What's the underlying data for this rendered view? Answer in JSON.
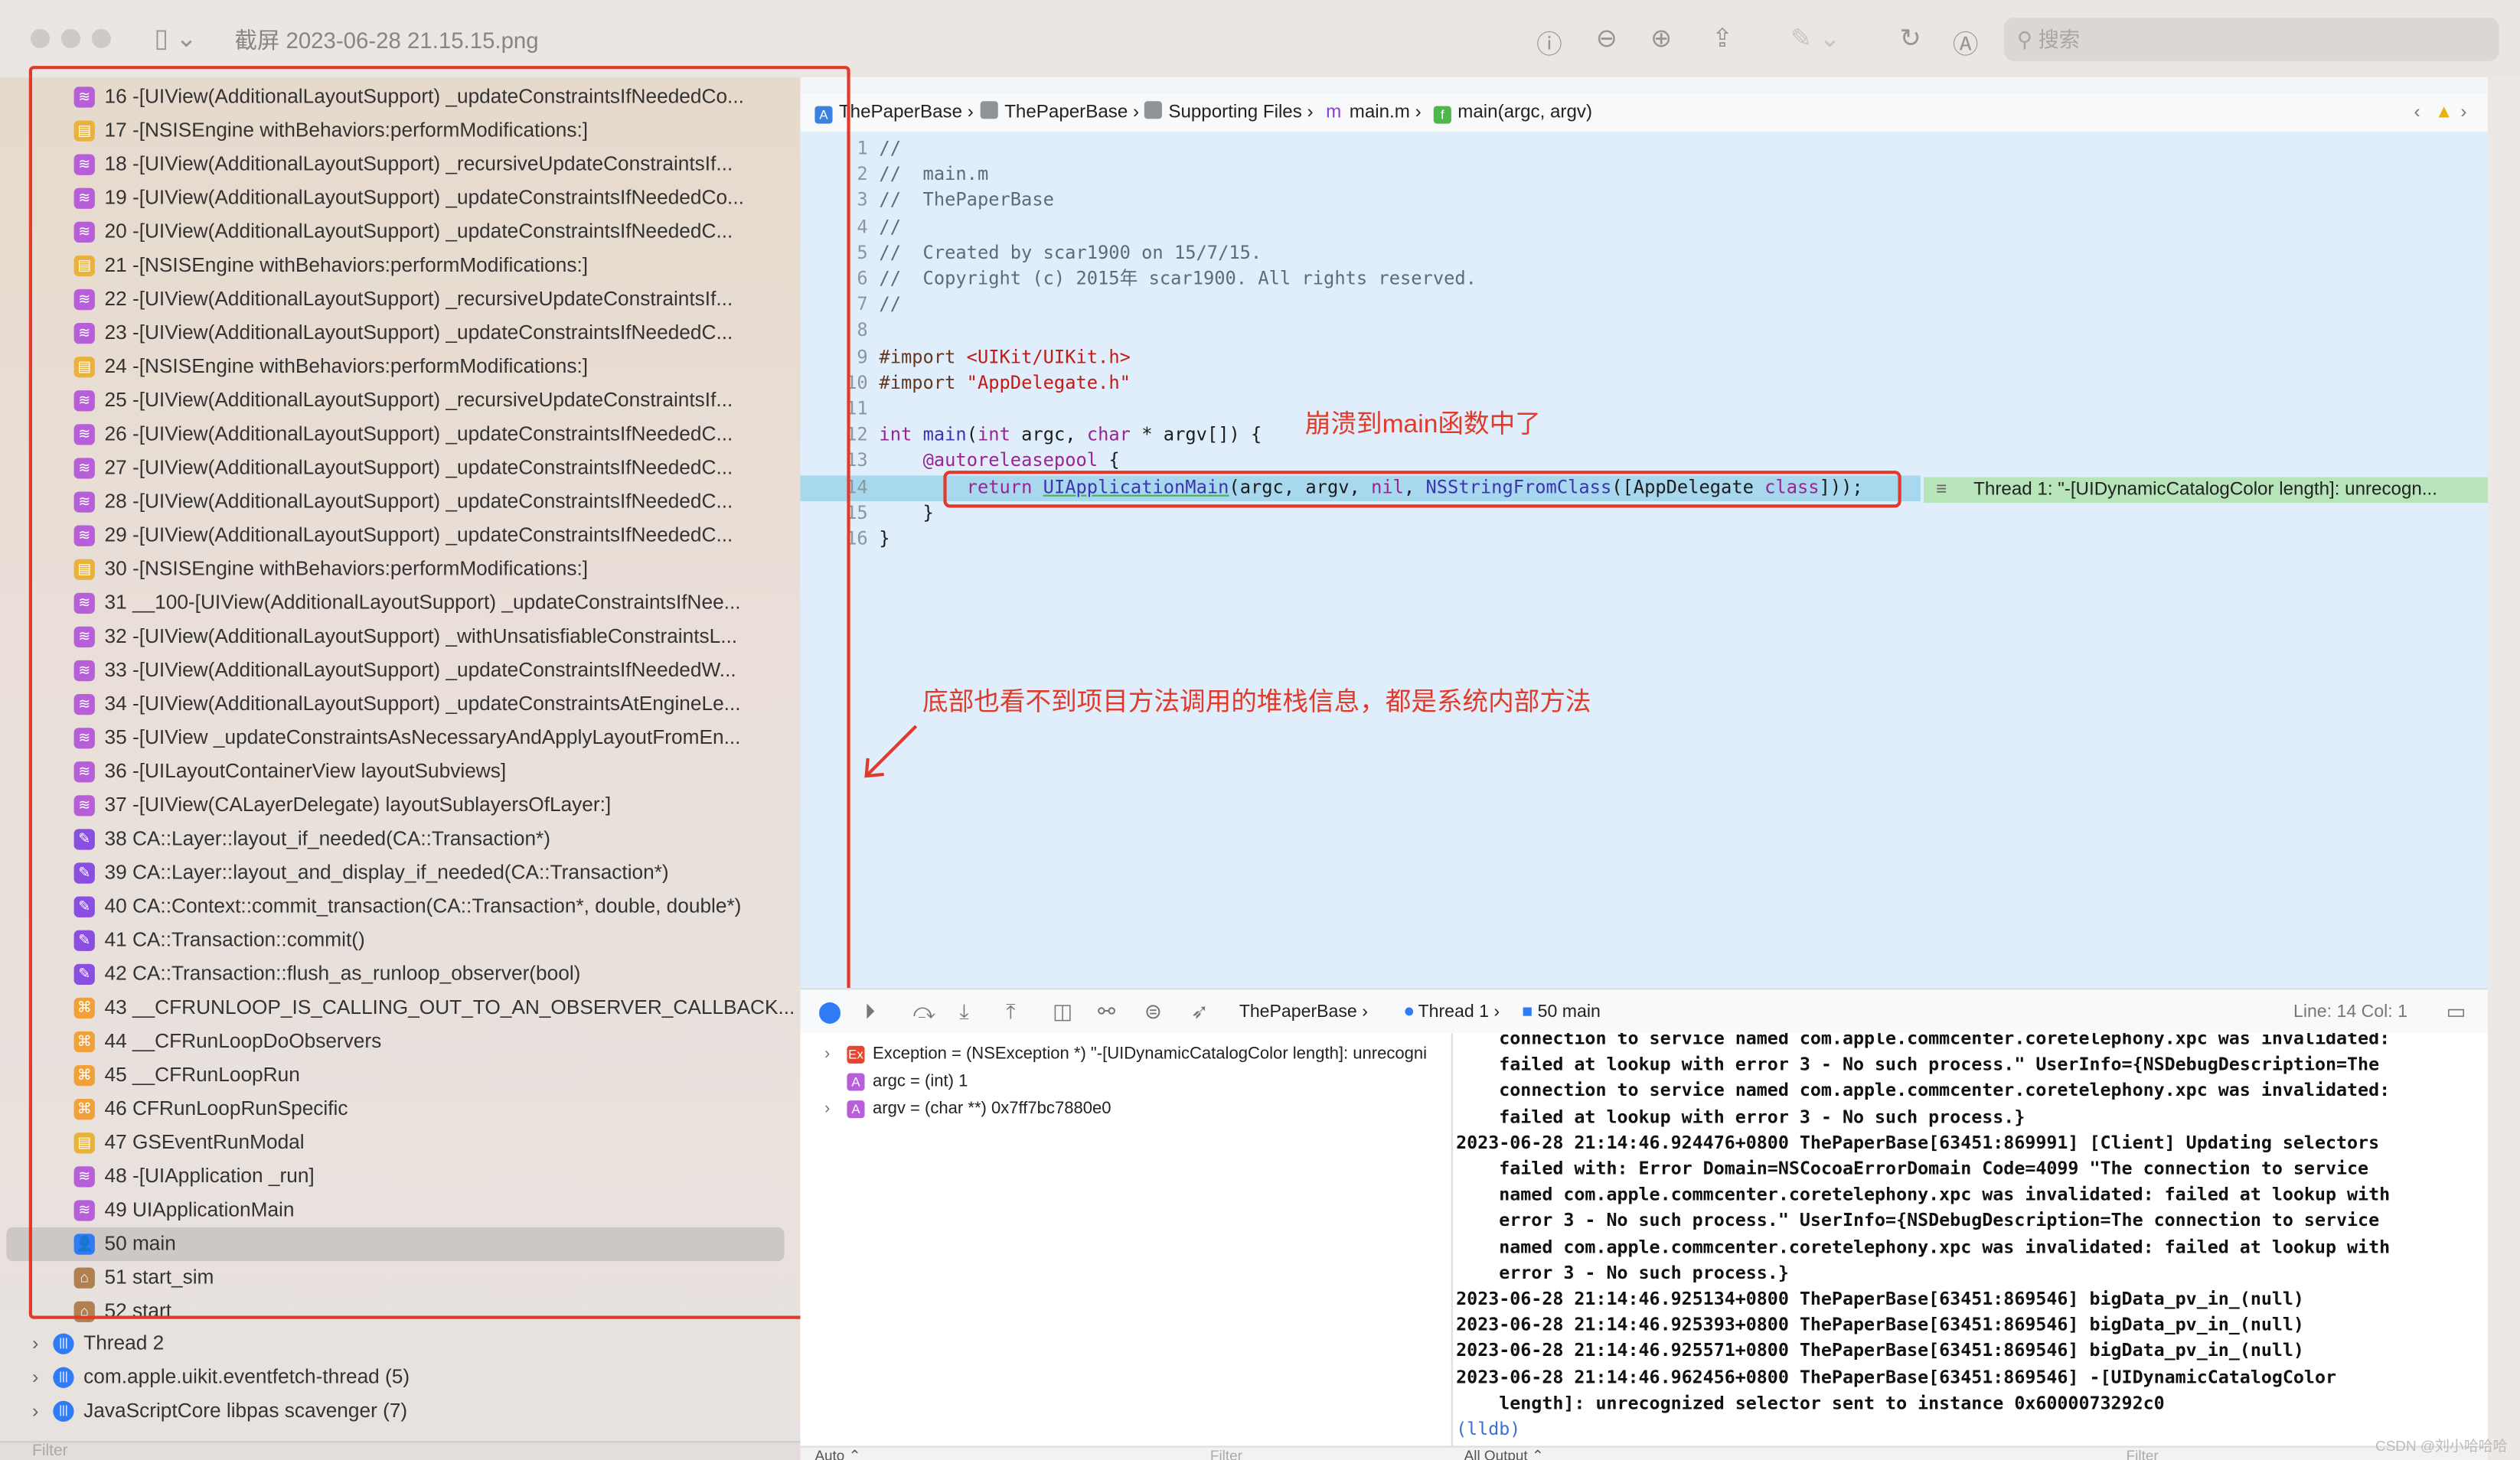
{
  "window": {
    "title": "截屏 2023-06-28 21.15.15.png",
    "search_placeholder": "搜索"
  },
  "colors": {
    "annotation": "#e23a2a",
    "highlight_line": "#a7d8ee",
    "error_banner": "#b7e4b8",
    "code_bg": "#dfeefa"
  },
  "stack_frames": [
    {
      "label": "16 -[UIView(AdditionalLayoutSupport) _updateConstraintsIfNeededCo...",
      "icon": "uikit"
    },
    {
      "label": "17 -[NSISEngine withBehaviors:performModifications:]",
      "icon": "foundation"
    },
    {
      "label": "18 -[UIView(AdditionalLayoutSupport) _recursiveUpdateConstraintsIf...",
      "icon": "uikit"
    },
    {
      "label": "19 -[UIView(AdditionalLayoutSupport) _updateConstraintsIfNeededCo...",
      "icon": "uikit"
    },
    {
      "label": "20 -[UIView(AdditionalLayoutSupport) _updateConstraintsIfNeededC...",
      "icon": "uikit"
    },
    {
      "label": "21 -[NSISEngine withBehaviors:performModifications:]",
      "icon": "foundation"
    },
    {
      "label": "22 -[UIView(AdditionalLayoutSupport) _recursiveUpdateConstraintsIf...",
      "icon": "uikit"
    },
    {
      "label": "23 -[UIView(AdditionalLayoutSupport) _updateConstraintsIfNeededC...",
      "icon": "uikit"
    },
    {
      "label": "24 -[NSISEngine withBehaviors:performModifications:]",
      "icon": "foundation"
    },
    {
      "label": "25 -[UIView(AdditionalLayoutSupport) _recursiveUpdateConstraintsIf...",
      "icon": "uikit"
    },
    {
      "label": "26 -[UIView(AdditionalLayoutSupport) _updateConstraintsIfNeededC...",
      "icon": "uikit"
    },
    {
      "label": "27 -[UIView(AdditionalLayoutSupport) _updateConstraintsIfNeededC...",
      "icon": "uikit"
    },
    {
      "label": "28 -[UIView(AdditionalLayoutSupport) _updateConstraintsIfNeededC...",
      "icon": "uikit"
    },
    {
      "label": "29 -[UIView(AdditionalLayoutSupport) _updateConstraintsIfNeededC...",
      "icon": "uikit"
    },
    {
      "label": "30 -[NSISEngine withBehaviors:performModifications:]",
      "icon": "foundation"
    },
    {
      "label": "31 __100-[UIView(AdditionalLayoutSupport) _updateConstraintsIfNee...",
      "icon": "uikit"
    },
    {
      "label": "32 -[UIView(AdditionalLayoutSupport) _withUnsatisfiableConstraintsL...",
      "icon": "uikit"
    },
    {
      "label": "33 -[UIView(AdditionalLayoutSupport) _updateConstraintsIfNeededW...",
      "icon": "uikit"
    },
    {
      "label": "34 -[UIView(AdditionalLayoutSupport) _updateConstraintsAtEngineLe...",
      "icon": "uikit"
    },
    {
      "label": "35 -[UIView _updateConstraintsAsNecessaryAndApplyLayoutFromEn...",
      "icon": "uikit"
    },
    {
      "label": "36 -[UILayoutContainerView layoutSubviews]",
      "icon": "uikit"
    },
    {
      "label": "37 -[UIView(CALayerDelegate) layoutSublayersOfLayer:]",
      "icon": "uikit"
    },
    {
      "label": "38 CA::Layer::layout_if_needed(CA::Transaction*)",
      "icon": "quartzcore"
    },
    {
      "label": "39 CA::Layer::layout_and_display_if_needed(CA::Transaction*)",
      "icon": "quartzcore"
    },
    {
      "label": "40 CA::Context::commit_transaction(CA::Transaction*, double, double*)",
      "icon": "quartzcore"
    },
    {
      "label": "41 CA::Transaction::commit()",
      "icon": "quartzcore"
    },
    {
      "label": "42 CA::Transaction::flush_as_runloop_observer(bool)",
      "icon": "quartzcore"
    },
    {
      "label": "43 __CFRUNLOOP_IS_CALLING_OUT_TO_AN_OBSERVER_CALLBACK...",
      "icon": "corefoundation"
    },
    {
      "label": "44 __CFRunLoopDoObservers",
      "icon": "corefoundation"
    },
    {
      "label": "45 __CFRunLoopRun",
      "icon": "corefoundation"
    },
    {
      "label": "46 CFRunLoopRunSpecific",
      "icon": "corefoundation"
    },
    {
      "label": "47 GSEventRunModal",
      "icon": "foundation"
    },
    {
      "label": "48 -[UIApplication _run]",
      "icon": "uikit"
    },
    {
      "label": "49 UIApplicationMain",
      "icon": "uikit"
    },
    {
      "label": "50 main",
      "icon": "user",
      "selected": true
    },
    {
      "label": "51 start_sim",
      "icon": "system"
    },
    {
      "label": "52 start",
      "icon": "system"
    }
  ],
  "threads": [
    {
      "label": "Thread 2"
    },
    {
      "label": "com.apple.uikit.eventfetch-thread (5)"
    },
    {
      "label": "JavaScriptCore libpas scavenger (7)"
    }
  ],
  "left_filter_placeholder": "Filter",
  "breadcrumb": [
    "ThePaperBase",
    "ThePaperBase",
    "Supporting Files",
    "main.m",
    "main(argc, argv)"
  ],
  "code_lines": [
    [
      [
        "//",
        "comment"
      ]
    ],
    [
      [
        "//  main.m",
        "comment"
      ]
    ],
    [
      [
        "//  ThePaperBase",
        "comment"
      ]
    ],
    [
      [
        "//",
        "comment"
      ]
    ],
    [
      [
        "//  Created by scar1900 on 15/7/15.",
        "comment"
      ]
    ],
    [
      [
        "//  Copyright (c) 2015年 scar1900. All rights reserved.",
        "comment"
      ]
    ],
    [
      [
        "//",
        "comment"
      ]
    ],
    [],
    [
      [
        "#import ",
        "pre"
      ],
      [
        "<UIKit/UIKit.h>",
        "str"
      ]
    ],
    [
      [
        "#import ",
        "pre"
      ],
      [
        "\"AppDelegate.h\"",
        "str"
      ]
    ],
    [],
    [
      [
        "int",
        "kw"
      ],
      [
        " ",
        "plain"
      ],
      [
        "main",
        "fn"
      ],
      [
        "(",
        "plain"
      ],
      [
        "int",
        "kw"
      ],
      [
        " argc, ",
        "plain"
      ],
      [
        "char",
        "kw"
      ],
      [
        " * argv[]) {",
        "plain"
      ]
    ],
    [
      [
        "    ",
        "plain"
      ],
      [
        "@autoreleasepool",
        "kw"
      ],
      [
        " {",
        "plain"
      ]
    ],
    [
      [
        "        ",
        "plain"
      ],
      [
        "return",
        "kw"
      ],
      [
        " ",
        "plain"
      ],
      [
        "UIApplicationMain",
        "und"
      ],
      [
        "(argc, argv, ",
        "plain"
      ],
      [
        "nil",
        "kw"
      ],
      [
        ", ",
        "plain"
      ],
      [
        "NSStringFromClass",
        "fn"
      ],
      [
        "([AppDelegate ",
        "plain"
      ],
      [
        "class",
        "kw"
      ],
      [
        "]));",
        "plain"
      ]
    ],
    [
      [
        "    }",
        "plain"
      ]
    ],
    [
      [
        "}",
        "plain"
      ]
    ]
  ],
  "current_line": 14,
  "error_banner": "Thread 1: \"-[UIDynamicCatalogColor length]: unrecogn...",
  "annotations": {
    "crash_in_main": "崩溃到main函数中了",
    "no_project_frames": "底部也看不到项目方法调用的堆栈信息，都是系统内部方法"
  },
  "debug_bar": {
    "target": "ThePaperBase",
    "thread": "Thread 1",
    "frame": "50 main",
    "position": "Line: 14  Col: 1"
  },
  "variables": [
    {
      "text": "Exception = (NSException *) \"-[UIDynamicCatalogColor length]: unrecogni",
      "icon": "exception",
      "expandable": true
    },
    {
      "text": "argc = (int) 1",
      "icon": "local",
      "expandable": false
    },
    {
      "text": "argv = (char **) 0x7ff7bc7880e0",
      "icon": "local",
      "expandable": true
    }
  ],
  "console_lines": [
    "    connection to service named com.apple.commcenter.coretelephony.xpc was invalidated:",
    "    failed at lookup with error 3 - No such process.\" UserInfo={NSDebugDescription=The",
    "    connection to service named com.apple.commcenter.coretelephony.xpc was invalidated:",
    "    failed at lookup with error 3 - No such process.}",
    "2023-06-28 21:14:46.924476+0800 ThePaperBase[63451:869991] [Client] Updating selectors",
    "    failed with: Error Domain=NSCocoaErrorDomain Code=4099 \"The connection to service",
    "    named com.apple.commcenter.coretelephony.xpc was invalidated: failed at lookup with",
    "    error 3 - No such process.\" UserInfo={NSDebugDescription=The connection to service",
    "    named com.apple.commcenter.coretelephony.xpc was invalidated: failed at lookup with",
    "    error 3 - No such process.}",
    "2023-06-28 21:14:46.925134+0800 ThePaperBase[63451:869546] bigData_pv_in_(null)",
    "2023-06-28 21:14:46.925393+0800 ThePaperBase[63451:869546] bigData_pv_in_(null)",
    "2023-06-28 21:14:46.925571+0800 ThePaperBase[63451:869546] bigData_pv_in_(null)",
    "2023-06-28 21:14:46.962456+0800 ThePaperBase[63451:869546] -[UIDynamicCatalogColor",
    "    length]: unrecognized selector sent to instance 0x6000073292c0"
  ],
  "console_prompt": "(lldb)",
  "bottom_bar": {
    "auto": "Auto ⌃",
    "filter": "Filter",
    "output": "All Output ⌃",
    "filter2": "Filter"
  },
  "watermark": "CSDN @刘小哈哈哈"
}
